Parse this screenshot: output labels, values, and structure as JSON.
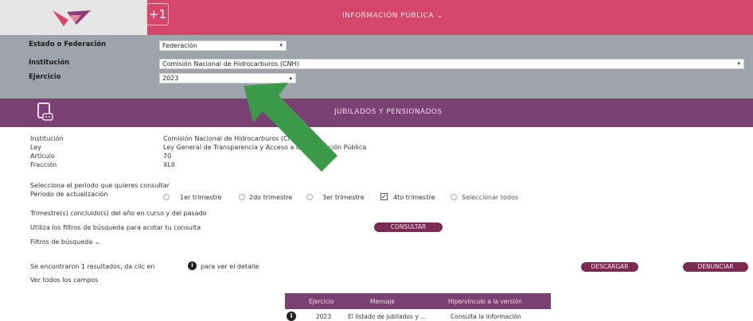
{
  "header": {
    "title": "INFORMACIÓN PÚBLICA ⌄",
    "new_icon_glyph": "+1"
  },
  "filters": {
    "estado_label": "Estado o Federación",
    "estado_value": "Federación",
    "institucion_label": "Institución",
    "institucion_value": "Comisión Nacional de Hidrocarburos (CNH)",
    "ejercicio_label": "Ejercicio",
    "ejercicio_value": "2023"
  },
  "section": {
    "title": "JUBILADOS Y PENSIONADOS"
  },
  "info": {
    "institucion_label": "Institución",
    "institucion_value": "Comisión Nacional de Hidrocarburos (CNH)",
    "ley_label": "Ley",
    "ley_value": "Ley General de Transparencia y Acceso a la Información Pública",
    "articulo_label": "Artículo",
    "articulo_value": "70",
    "fraccion_label": "Fracción",
    "fraccion_value": "XLII"
  },
  "period": {
    "prompt": "Selecciona el periodo que quieres consultar",
    "label": "Periodo de actualización",
    "options": [
      "1er trimestre",
      "2do trimestre",
      "3er trimestre",
      "4to trimestre",
      "Seleccionar todos"
    ],
    "checked": "4to trimestre"
  },
  "trimestres_text": "Trimestre(s) concluido(s) del año en curso y del pasado",
  "filters_hint": "Utiliza los filtros de búsqueda para acotar tu consulta",
  "consultar_label": "CONSULTAR",
  "filtros_busqueda_label": "Filtros de búsqueda ⌄",
  "results": {
    "summary_prefix": "Se encontraron 1 resultados, da clic en",
    "summary_suffix": "para ver el detalle",
    "ver_todos": "Ver todos los campos",
    "descargar_label": "DESCARGAR",
    "denunciar_label": "DENUNCIAR",
    "columns": [
      "Ejercicio",
      "Mensaje",
      "Hipervínculo a la versión"
    ],
    "rows": [
      {
        "ejercicio": "2023",
        "mensaje": "El listado de jubilados y ...",
        "hipervinculo": "Consulta la información"
      }
    ]
  },
  "colors": {
    "topbar": "#d6456b",
    "filter_panel": "#9ea4ab",
    "section": "#7a3f73",
    "button": "#7a2b54",
    "arrow": "#3a9a4a"
  },
  "icons": {
    "new": "new-tab-icon",
    "section": "document-icon",
    "info": "info-icon",
    "arrow": "arrow-icon"
  }
}
